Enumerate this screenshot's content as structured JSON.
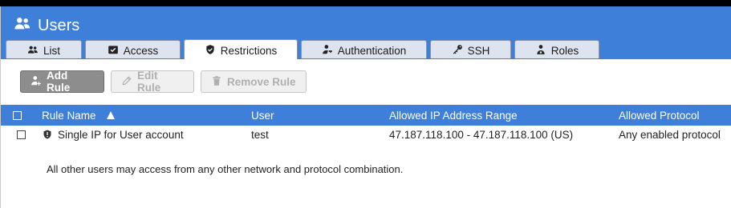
{
  "header": {
    "title": "Users"
  },
  "tabs": [
    {
      "label": "List",
      "icon": "users-icon"
    },
    {
      "label": "Access",
      "icon": "check-box-icon"
    },
    {
      "label": "Restrictions",
      "icon": "shield-icon",
      "active": true
    },
    {
      "label": "Authentication",
      "icon": "user-key-icon"
    },
    {
      "label": "SSH",
      "icon": "key-icon"
    },
    {
      "label": "Roles",
      "icon": "user-badge-icon"
    }
  ],
  "toolbar": {
    "add_rule": "Add Rule",
    "edit_rule": "Edit Rule",
    "remove_rule": "Remove Rule"
  },
  "table": {
    "columns": [
      "Rule Name",
      "User",
      "Allowed IP Address Range",
      "Allowed Protocol"
    ],
    "sort": {
      "column": "Rule Name",
      "direction": "ascending"
    },
    "rows": [
      {
        "rule_name": "Single IP for User account",
        "user": "test",
        "ip_range": "47.187.118.100 - 47.187.118.100 (US)",
        "protocol": "Any enabled protocol"
      }
    ]
  },
  "note": "All other users may access from any other network and protocol combination.",
  "colors": {
    "accent": "#3d7fd9",
    "button_primary": "#8d8d8d"
  }
}
